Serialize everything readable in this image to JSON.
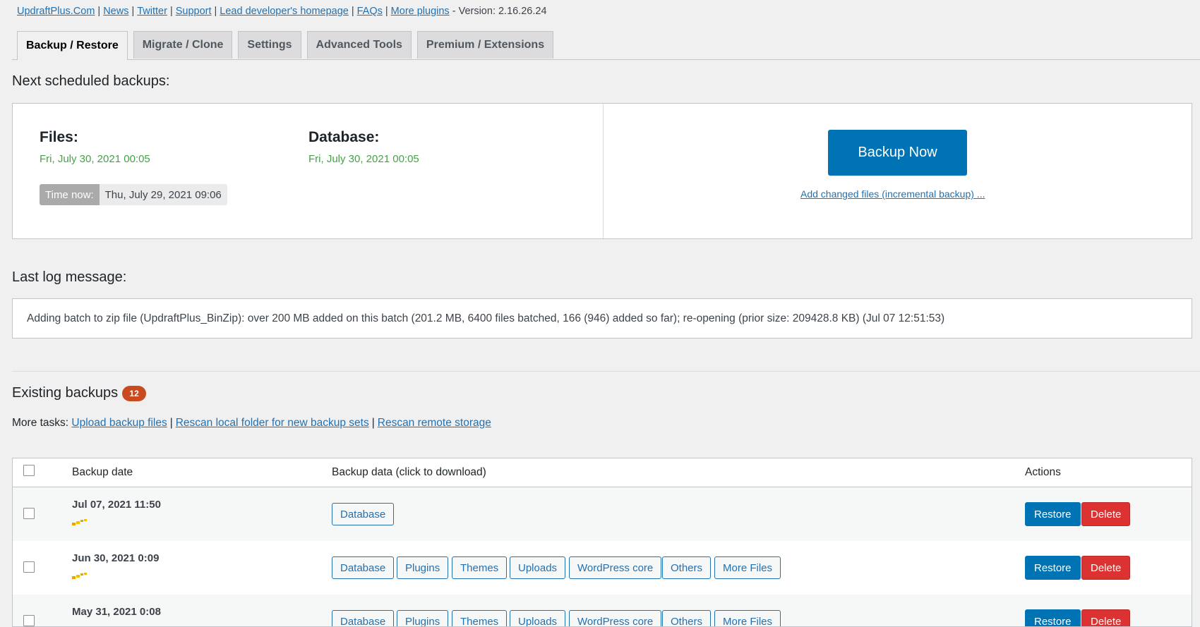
{
  "top_links": {
    "links": [
      "UpdraftPlus.Com",
      "News",
      "Twitter",
      "Support",
      "Lead developer's homepage",
      "FAQs",
      "More plugins"
    ],
    "version_text": "- Version: 2.16.26.24"
  },
  "tabs": [
    {
      "label": "Backup / Restore",
      "active": true
    },
    {
      "label": "Migrate / Clone",
      "active": false
    },
    {
      "label": "Settings",
      "active": false
    },
    {
      "label": "Advanced Tools",
      "active": false
    },
    {
      "label": "Premium / Extensions",
      "active": false
    }
  ],
  "scheduled": {
    "heading": "Next scheduled backups:",
    "files_label": "Files:",
    "files_date": "Fri, July 30, 2021 00:05",
    "database_label": "Database:",
    "database_date": "Fri, July 30, 2021 00:05",
    "time_now_label": "Time now:",
    "time_now_value": "Thu, July 29, 2021 09:06",
    "backup_now_label": "Backup Now",
    "incremental_link": "Add changed files (incremental backup) ..."
  },
  "log": {
    "heading": "Last log message:",
    "message": "Adding batch to zip file (UpdraftPlus_BinZip): over 200 MB added on this batch (201.2 MB, 6400 files batched, 166 (946) added so far); re-opening (prior size: 209428.8 KB) (Jul 07 12:51:53)"
  },
  "existing": {
    "heading": "Existing backups",
    "count": "12",
    "more_tasks_label": "More tasks:",
    "tasks": [
      "Upload backup files",
      "Rescan local folder for new backup sets",
      "Rescan remote storage"
    ]
  },
  "table": {
    "headers": {
      "date": "Backup date",
      "data": "Backup data (click to download)",
      "actions": "Actions"
    },
    "restore_label": "Restore",
    "delete_label": "Delete",
    "rows": [
      {
        "date": "Jul 07, 2021 11:50",
        "items": [
          "Database"
        ]
      },
      {
        "date": "Jun 30, 2021 0:09",
        "items": [
          "Database",
          "Plugins",
          "Themes",
          "Uploads",
          "WordPress core",
          "Others",
          "More Files"
        ]
      },
      {
        "date": "May 31, 2021 0:08",
        "items": [
          "Database",
          "Plugins",
          "Themes",
          "Uploads",
          "WordPress core",
          "Others",
          "More Files"
        ]
      }
    ]
  },
  "colors": {
    "primary": "#0073b5",
    "danger": "#dc3232",
    "success_text": "#46a147",
    "badge": "#ca4a1f"
  }
}
